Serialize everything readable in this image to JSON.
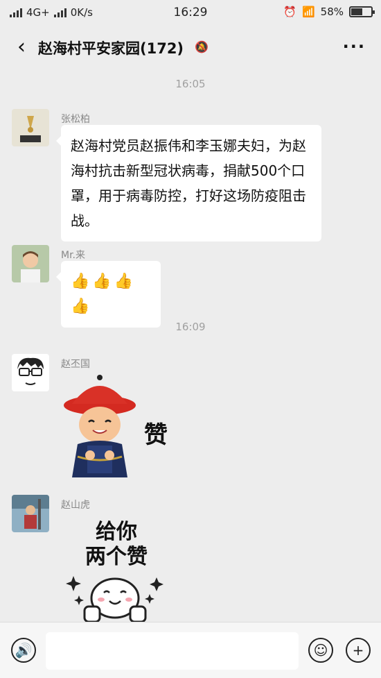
{
  "status_bar": {
    "network": "4G+",
    "speed": "0K/s",
    "time": "16:29",
    "battery": "58%",
    "battery_level": 0.58
  },
  "header": {
    "back_icon": "chevron-left-icon",
    "title": "赵海村平安家园(172)",
    "mute_icon": "bell-muted-icon",
    "more_icon": "ellipsis-icon"
  },
  "messages": [
    {
      "type": "timestamp",
      "text": "16:05"
    },
    {
      "sender": "张松柏",
      "text": "赵海村党员赵振伟和李玉娜夫妇，为赵海村抗击新型冠状病毒，捐献500个口罩，用于病毒防控，打好这场防疫阻击战。"
    },
    {
      "sender": "Mr.来",
      "text": "👍👍👍👍"
    },
    {
      "type": "timestamp",
      "text": "16:09"
    },
    {
      "sender": "赵丕国",
      "sticker_text": "赞"
    },
    {
      "sender": "赵山虎",
      "sticker_text": "给你\n两个赞"
    }
  ],
  "input_bar": {
    "voice_icon": "voice-icon",
    "emoji_icon": "emoji-icon",
    "plus_icon": "plus-icon"
  }
}
